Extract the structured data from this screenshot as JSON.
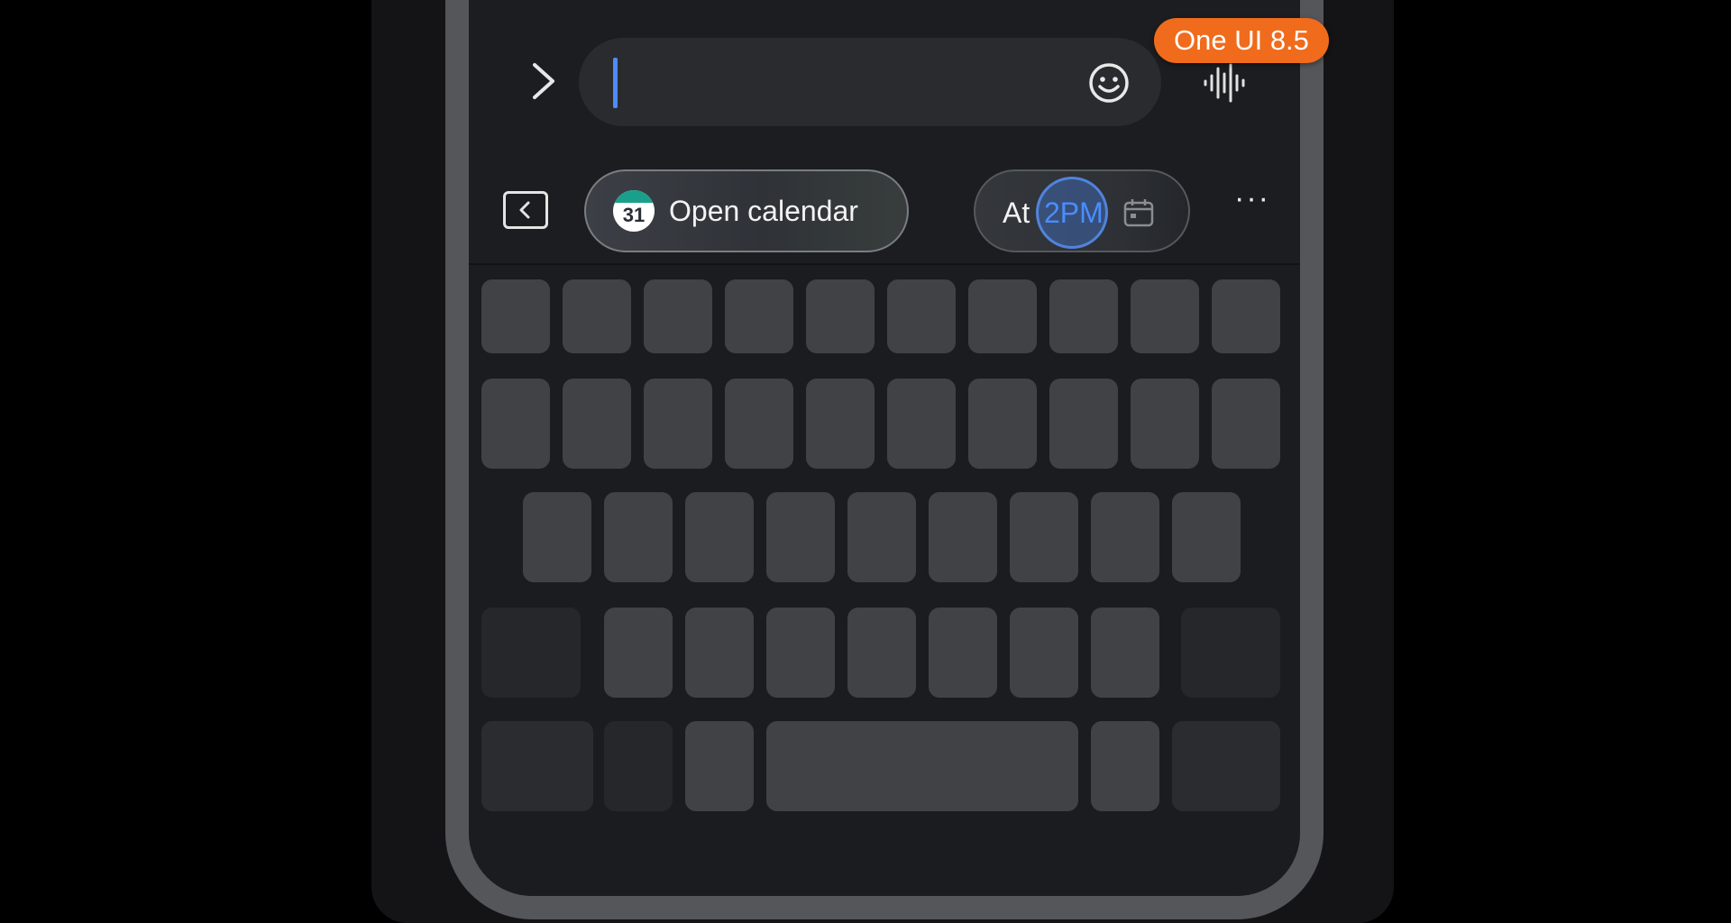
{
  "badge": {
    "text": "One UI 8.5"
  },
  "input": {
    "value": ""
  },
  "icons": {
    "expand": "chevron-right-icon",
    "emoji": "emoji-icon",
    "voice": "voice-waveform-icon",
    "back": "chevron-left-icon",
    "calendar": "calendar-icon",
    "more": "more-horizontal-icon"
  },
  "suggestions": {
    "open_calendar": {
      "label": "Open calendar",
      "icon_day": "31"
    },
    "time": {
      "prefix": "At",
      "highlight": "2PM"
    }
  },
  "more": {
    "label": "···"
  },
  "colors": {
    "badge": "#f06b1c",
    "caret": "#4d8bff",
    "highlight": "#4a8dff",
    "calendar_band": "#1aa08a"
  }
}
